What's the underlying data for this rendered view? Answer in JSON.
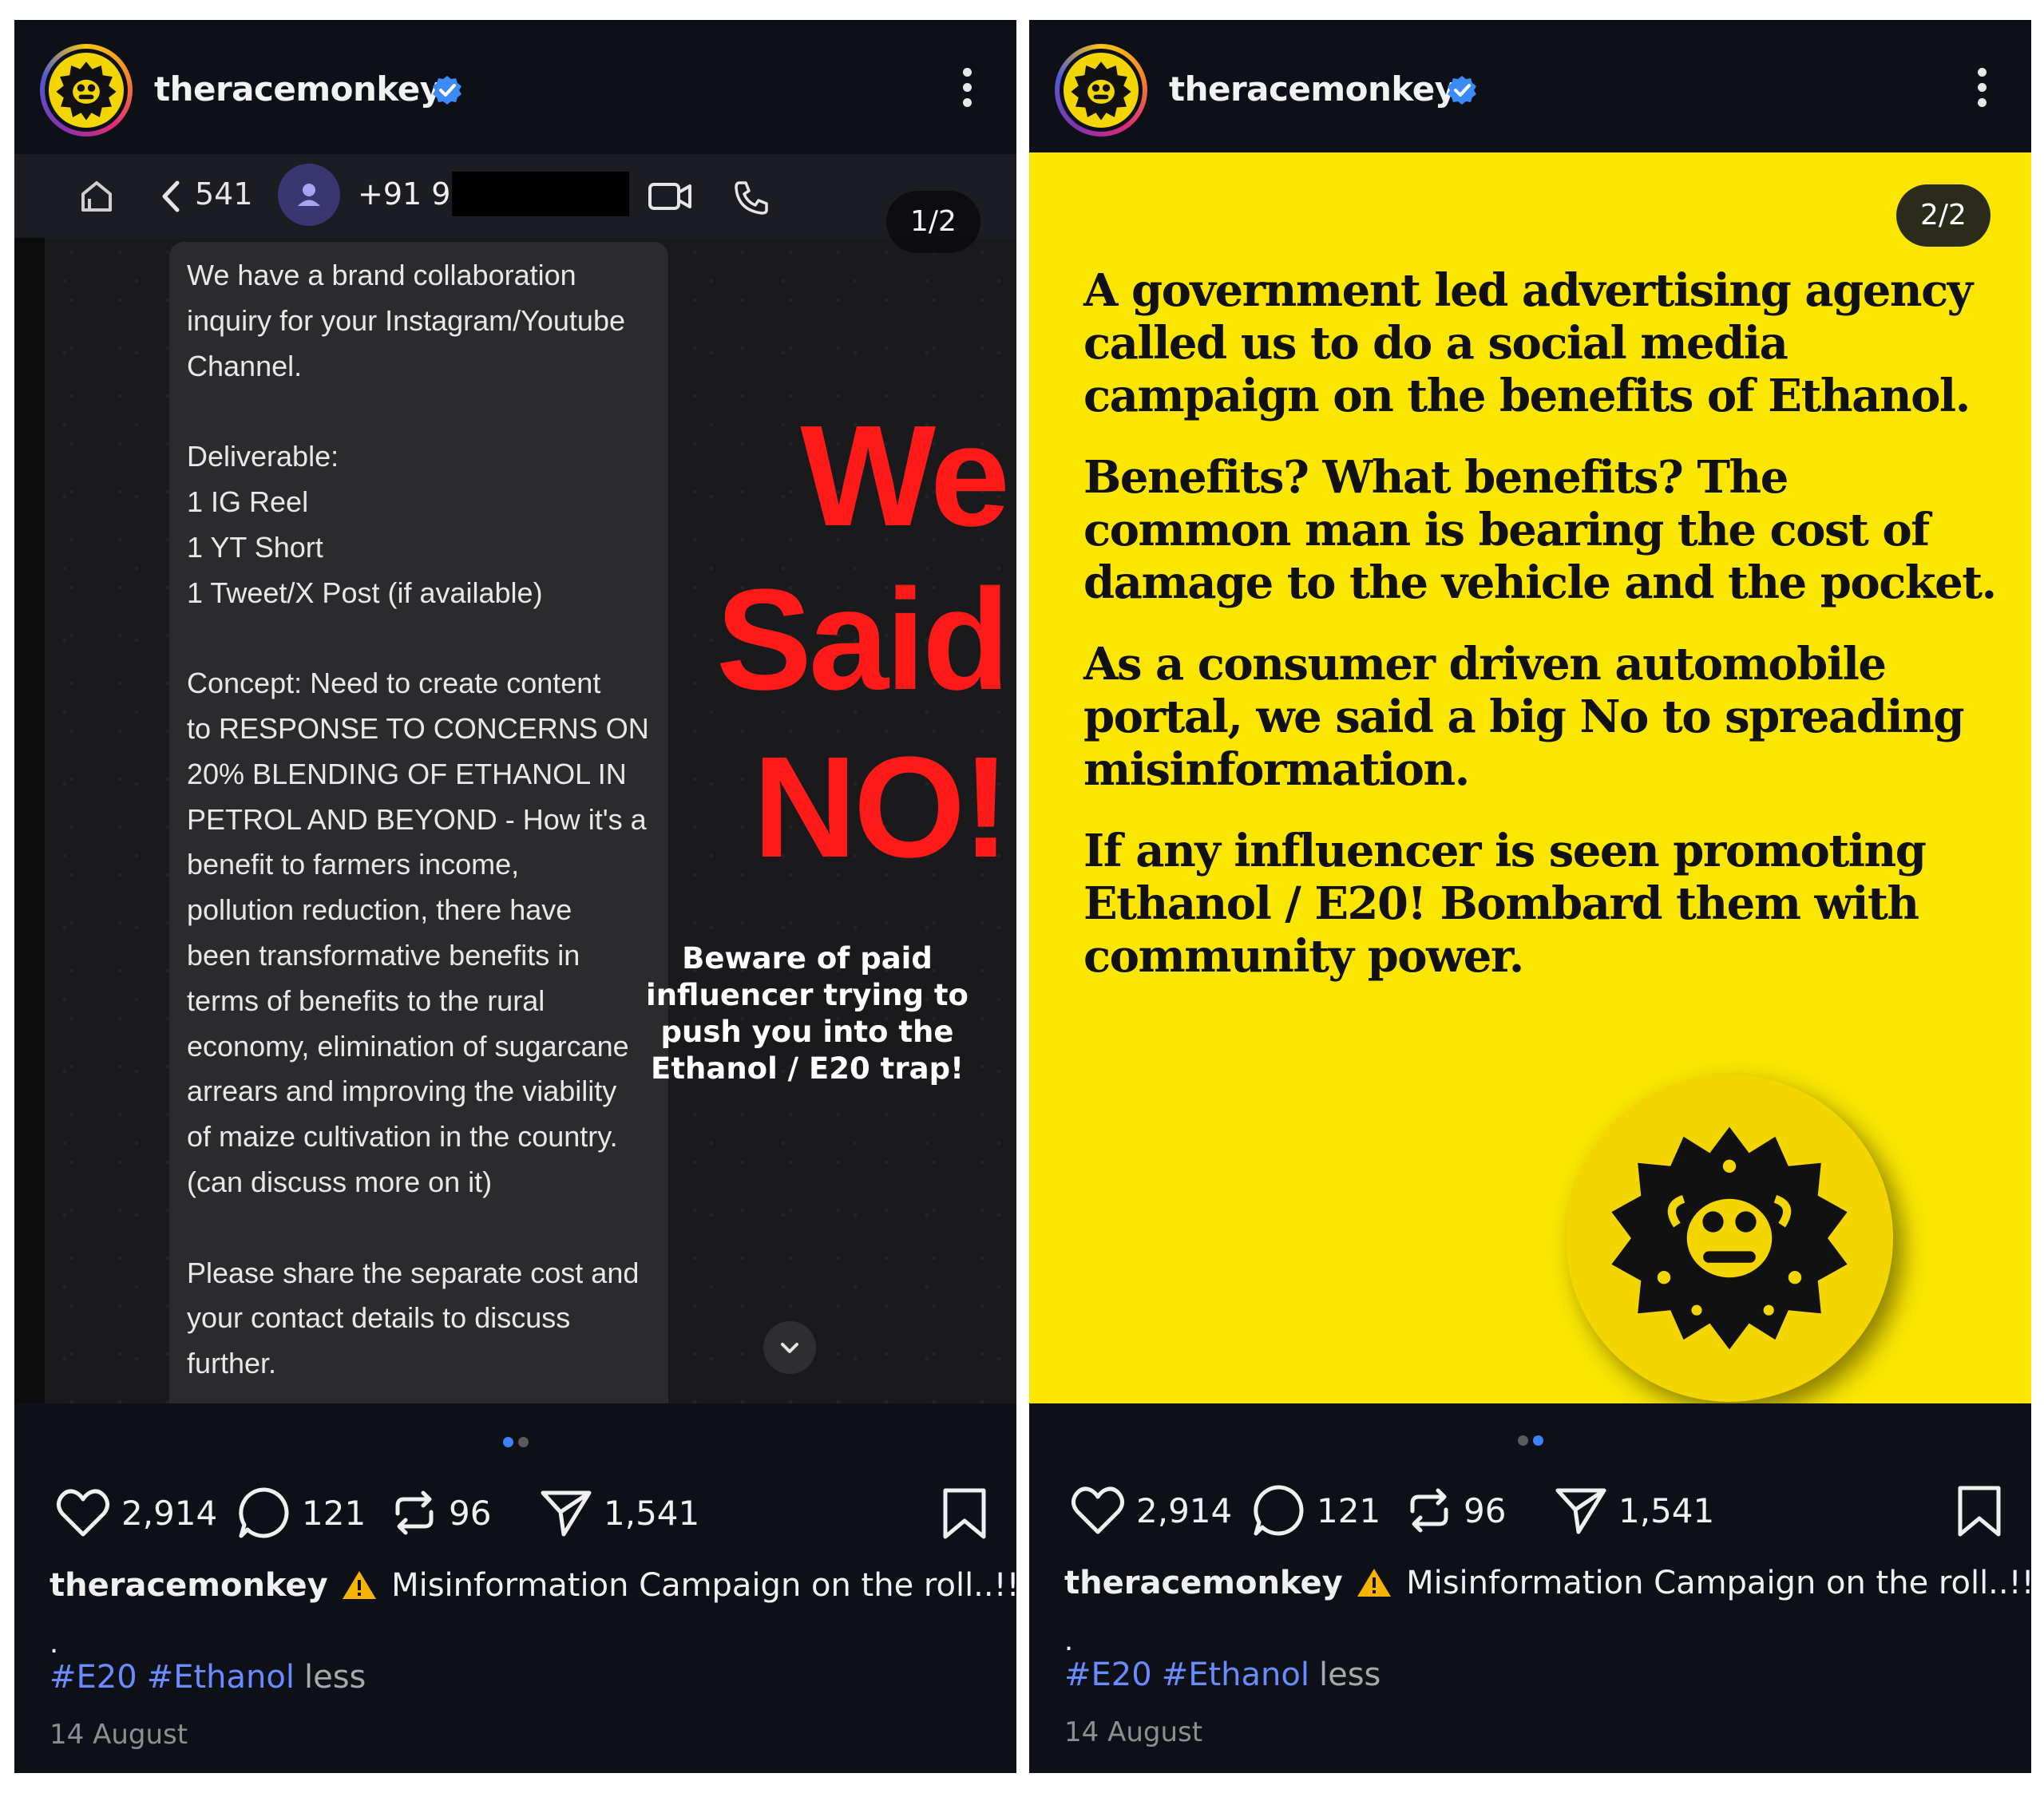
{
  "posts": [
    {
      "username": "theracemonkey",
      "verified": true,
      "slide_counter": "1/2",
      "chat_header": {
        "count": "541",
        "contact": "+91 99"
      },
      "message_lines": [
        "We have a brand collaboration",
        "inquiry for your Instagram/Youtube",
        "Channel.",
        "",
        "Deliverable:",
        "1 IG Reel",
        "1 YT Short",
        "1 Tweet/X Post (if available)",
        "",
        "Concept: Need to create content",
        "to RESPONSE TO CONCERNS ON",
        "20% BLENDING OF ETHANOL IN",
        "PETROL AND BEYOND - How it's a",
        "benefit to farmers income,",
        "pollution reduction, there have",
        "been transformative benefits in",
        "terms of benefits to the rural",
        "economy, elimination of sugarcane",
        "arrears and improving the viability",
        "of maize cultivation in the country.",
        "(can discuss more on it)",
        "",
        "Please share the separate cost and",
        "your contact details to discuss",
        "further."
      ],
      "overlay": {
        "word1": "We",
        "word2": "Said",
        "word3": "NO!",
        "beware": "Beware of paid influencer trying to push you into the Ethanol / E20 trap!"
      },
      "likes": "2,914",
      "comments": "121",
      "reposts": "96",
      "shares": "1,541",
      "caption_user": "theracemonkey",
      "caption_text": "Misinformation Campaign on the roll..!!!",
      "caption_dot": ".",
      "tags": [
        "#E20",
        "#Ethanol"
      ],
      "more_label": "less",
      "date": "14 August",
      "active_dot": 0
    },
    {
      "username": "theracemonkey",
      "verified": true,
      "slide_counter": "2/2",
      "paragraphs": [
        "A government led advertising agency called us to do a social media campaign on the benefits of Ethanol.",
        "Benefits? What benefits? The common man is bearing the cost of damage to the vehicle and the pocket.",
        "As a consumer driven automobile portal, we said a big No to spreading misinformation.",
        "If any influencer is seen promoting Ethanol / E20! Bombard them with community power."
      ],
      "likes": "2,914",
      "comments": "121",
      "reposts": "96",
      "shares": "1,541",
      "caption_user": "theracemonkey",
      "caption_text": "Misinformation Campaign on the roll..!!!",
      "caption_dot": ".",
      "tags": [
        "#E20",
        "#Ethanol"
      ],
      "more_label": "less",
      "date": "14 August",
      "active_dot": 1
    }
  ],
  "colors": {
    "background": "#0e1018",
    "accent_blue": "#3c82f6",
    "hashtag": "#6a8bff",
    "red_overlay": "#ff1a1a",
    "yellow_slide": "#fae600"
  },
  "icons": [
    "verified-badge-icon",
    "more-options-icon",
    "heart-icon",
    "comment-icon",
    "repost-icon",
    "share-icon",
    "bookmark-icon",
    "home-icon",
    "back-arrow-icon",
    "video-call-icon",
    "phone-icon",
    "chevron-down-icon",
    "warning-icon"
  ]
}
